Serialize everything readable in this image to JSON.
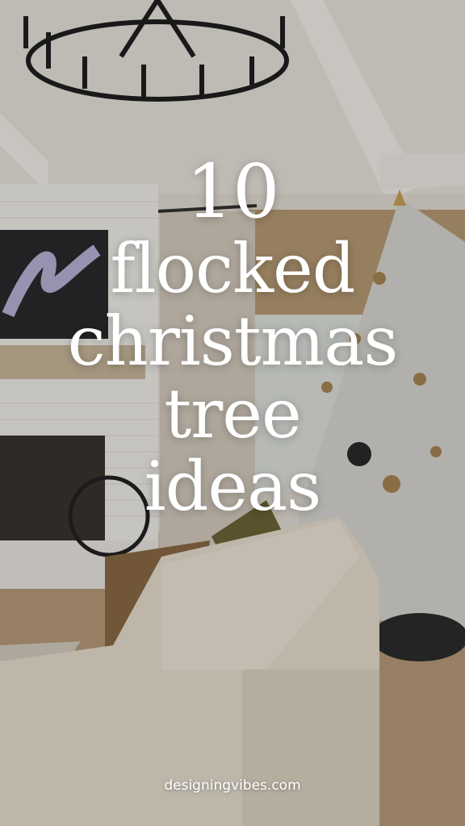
{
  "title": {
    "number": "10",
    "lines": [
      "flocked",
      "christmas",
      "tree",
      "ideas"
    ]
  },
  "credit": "designingvibes.com",
  "palette": {
    "ceiling": "#e7e2da",
    "brick": "#f1eee9",
    "sofa": "#e6ddcc",
    "floor": "#b89a78",
    "tree": "#d9d8d3",
    "overlay": "#00000033"
  }
}
